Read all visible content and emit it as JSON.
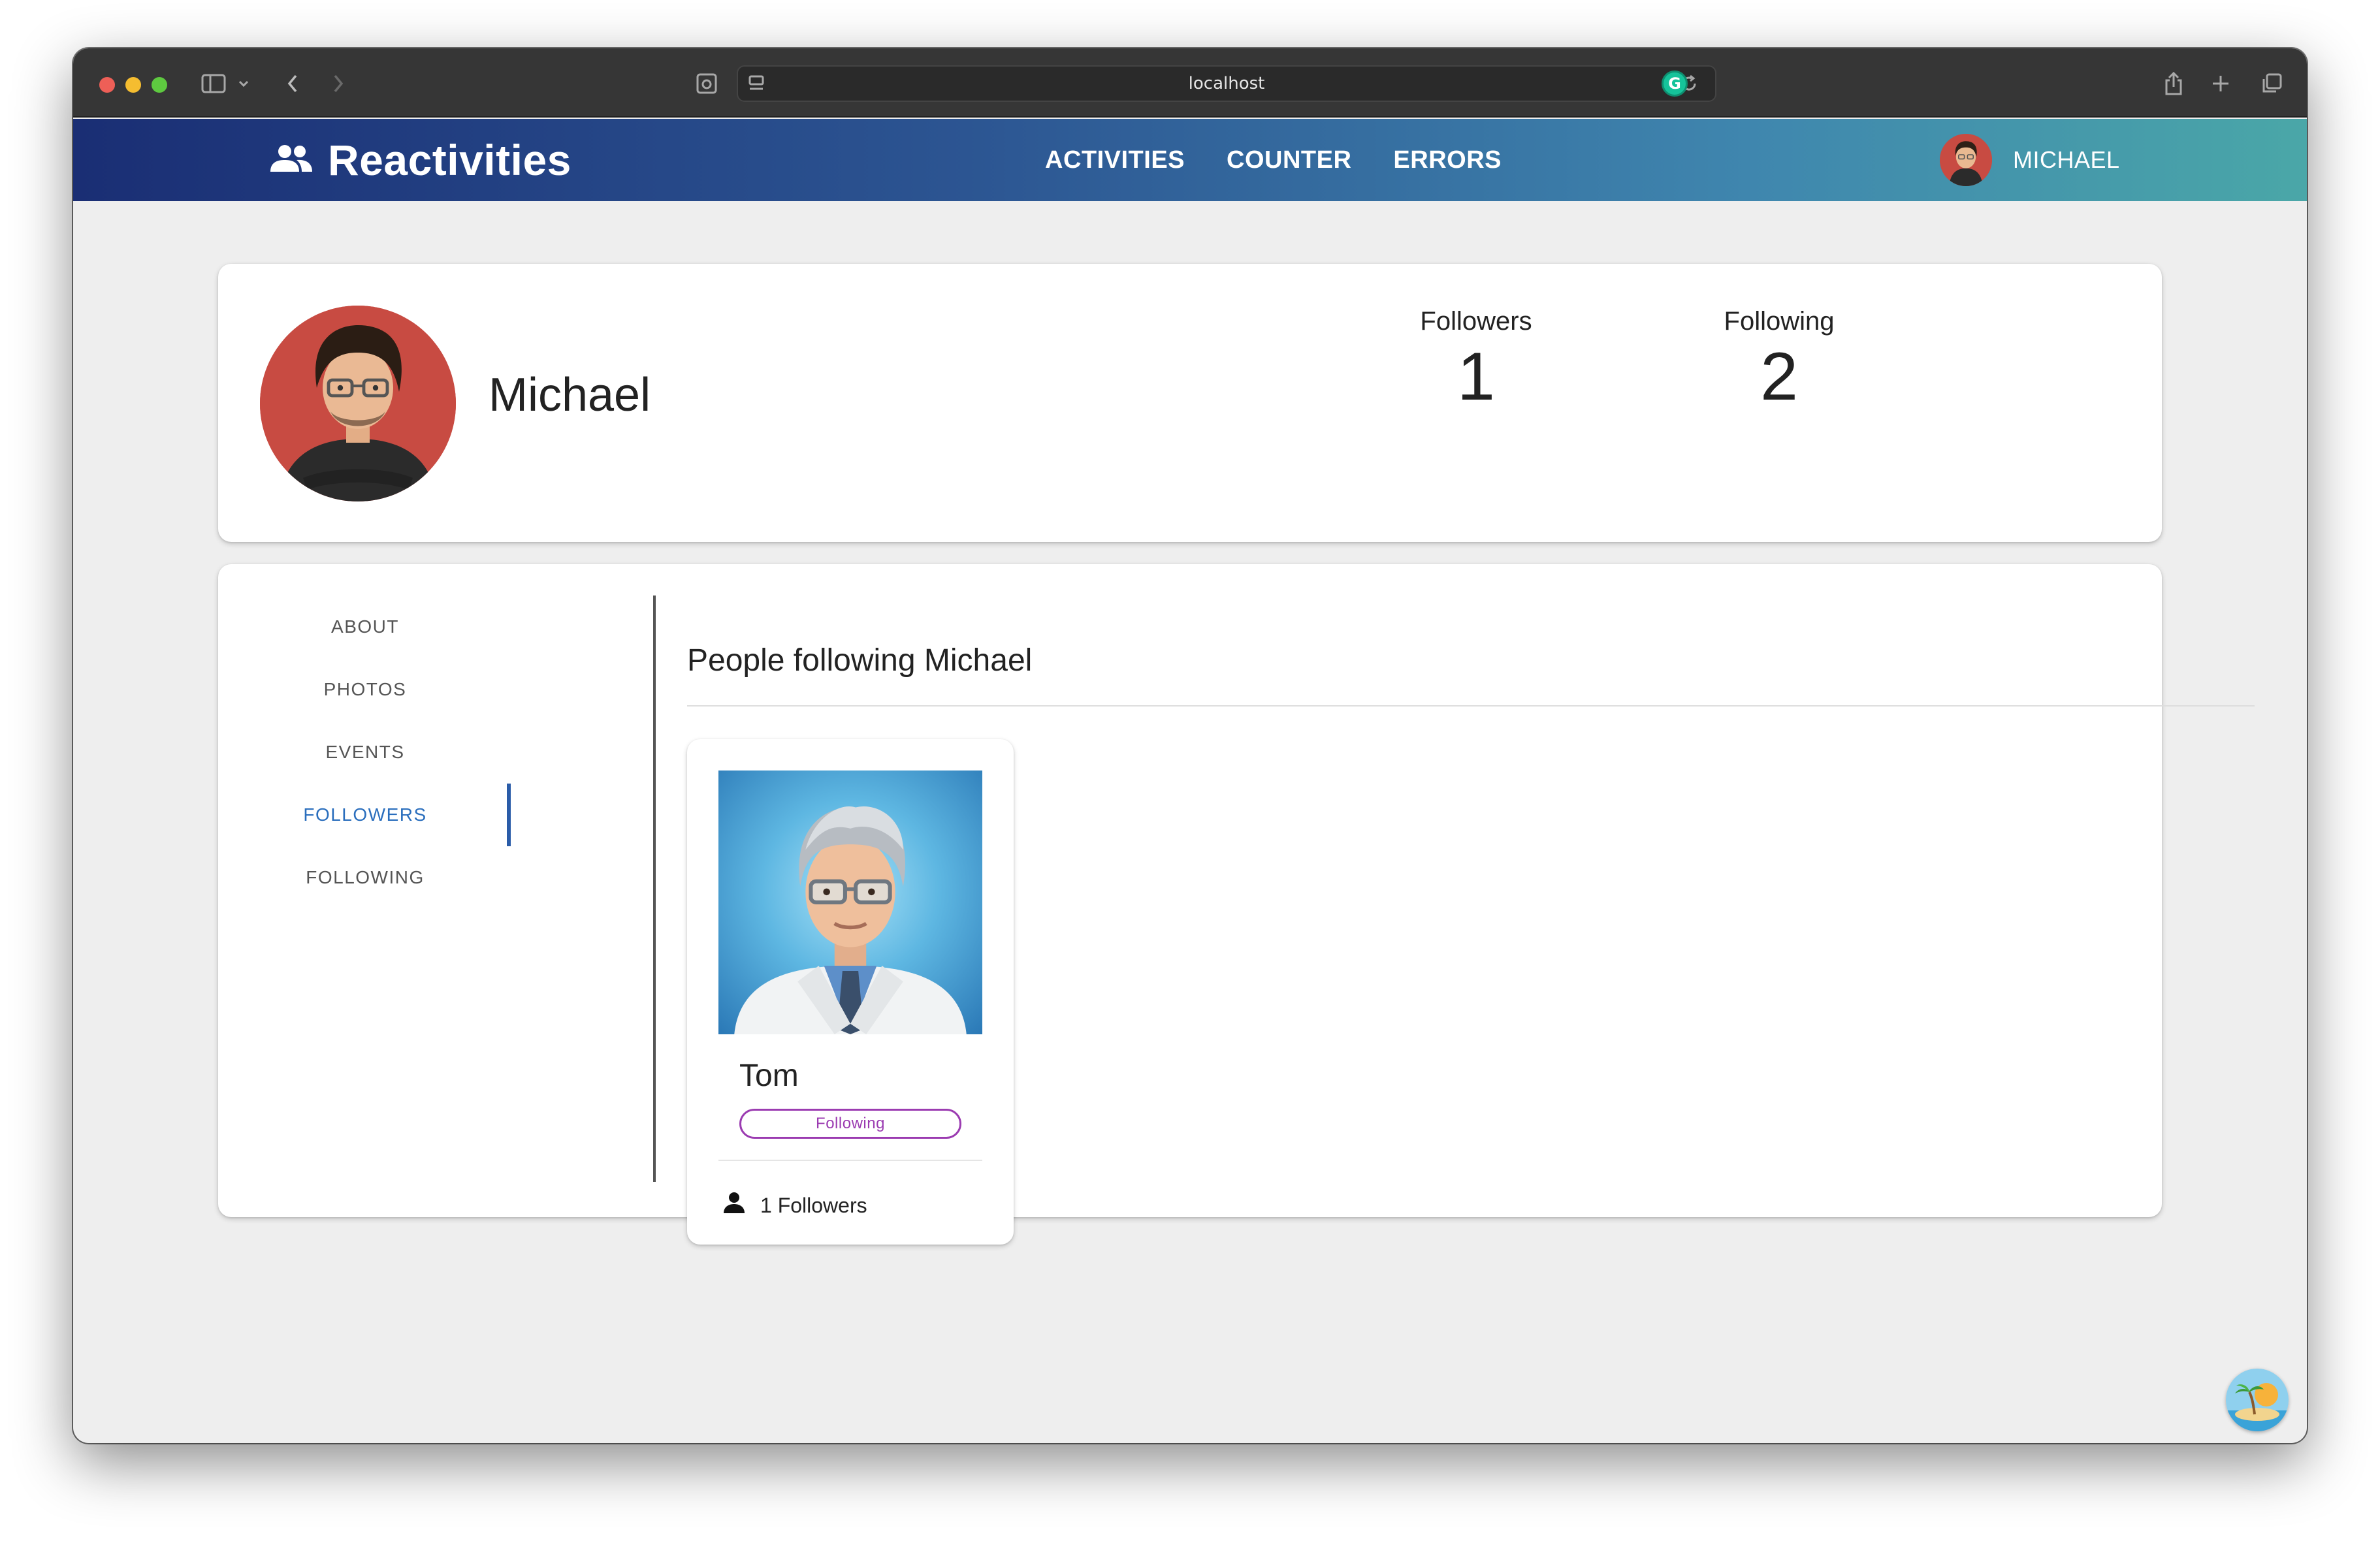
{
  "browser": {
    "url": "localhost"
  },
  "app": {
    "brand": "Reactivities",
    "nav": [
      "ACTIVITIES",
      "COUNTER",
      "ERRORS"
    ],
    "user_name": "MICHAEL"
  },
  "profile": {
    "name": "Michael",
    "stats": [
      {
        "label": "Followers",
        "value": "1"
      },
      {
        "label": "Following",
        "value": "2"
      }
    ]
  },
  "tabs": [
    "ABOUT",
    "PHOTOS",
    "EVENTS",
    "FOLLOWERS",
    "FOLLOWING"
  ],
  "active_tab": "FOLLOWERS",
  "section": {
    "title": "People following Michael"
  },
  "followers": [
    {
      "name": "Tom",
      "chip": "Following",
      "followers_label": "1 Followers"
    }
  ],
  "colors": {
    "accent": "#2a6ebd",
    "chip": "#9b3bb1",
    "header_start": "#1a2e74",
    "header_end": "#4aa7a8"
  }
}
